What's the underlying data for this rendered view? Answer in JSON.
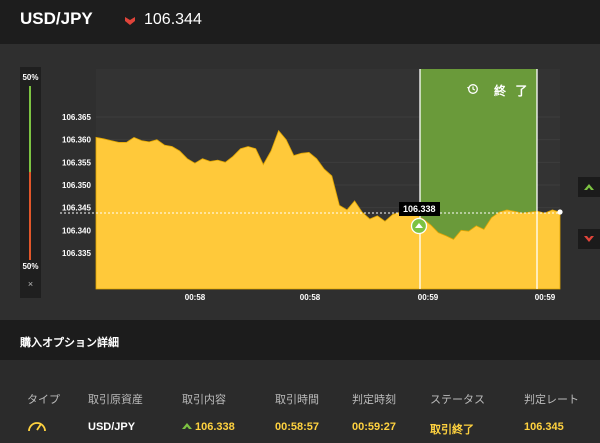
{
  "header": {
    "pair": "USD/JPY",
    "price": "106.344",
    "direction_icon": "down-arrow-icon",
    "down_color": "#e0443a"
  },
  "side_panel": {
    "top_pct": "50%",
    "bottom_pct": "50%",
    "close": "×",
    "up_color": "#7cc242",
    "down_color": "#e0562a"
  },
  "chart": {
    "end_label": "終 了",
    "price_tag": "106.338",
    "call_icon": "up-arrow-icon",
    "put_icon": "down-arrow-icon",
    "area_color": "#ffc93a",
    "window_color": "#6a9a3a"
  },
  "chart_data": {
    "type": "area",
    "yticks": [
      "106.365",
      "106.360",
      "106.355",
      "106.350",
      "106.345",
      "106.340",
      "106.335"
    ],
    "xticks": [
      "00:58",
      "00:58",
      "00:59",
      "00:59"
    ],
    "current_price": 106.344,
    "entry_price": 106.338,
    "series": [
      {
        "values": [
          106.3605,
          106.3602,
          106.3598,
          106.3594,
          106.3594,
          106.3605,
          106.3598,
          106.3595,
          106.36,
          106.3588,
          106.3585,
          106.3575,
          106.3558,
          106.3548,
          106.3558,
          106.3552,
          106.3555,
          106.355,
          106.3563,
          106.358,
          106.3585,
          106.358,
          106.3545,
          106.3575,
          106.362,
          106.36,
          106.3565,
          106.357,
          106.3572,
          106.3558,
          106.3535,
          106.352,
          106.3455,
          106.3445,
          106.3465,
          106.344,
          106.3425,
          106.3432,
          106.342,
          106.3435,
          106.344,
          106.3432,
          106.3435,
          106.3425,
          106.3412,
          106.3395,
          106.3388,
          106.338,
          106.34,
          106.3398,
          106.341,
          106.3402,
          106.3428,
          106.344,
          106.3445,
          106.3442,
          106.3438,
          106.344,
          106.3442,
          106.3438,
          106.3445,
          106.344
        ]
      }
    ]
  },
  "details": {
    "title": "購入オプション詳細"
  },
  "table": {
    "headers": [
      "タイプ",
      "取引原資産",
      "取引内容",
      "取引時間",
      "判定時刻",
      "ステータス",
      "判定レート"
    ],
    "row": {
      "type_icon": "gauge-icon",
      "asset": "USD/JPY",
      "direction_icon": "up-arrow-icon",
      "content": "106.338",
      "trade_time": "00:58:57",
      "judge_time": "00:59:27",
      "status": "取引終了",
      "rate": "106.345"
    }
  }
}
